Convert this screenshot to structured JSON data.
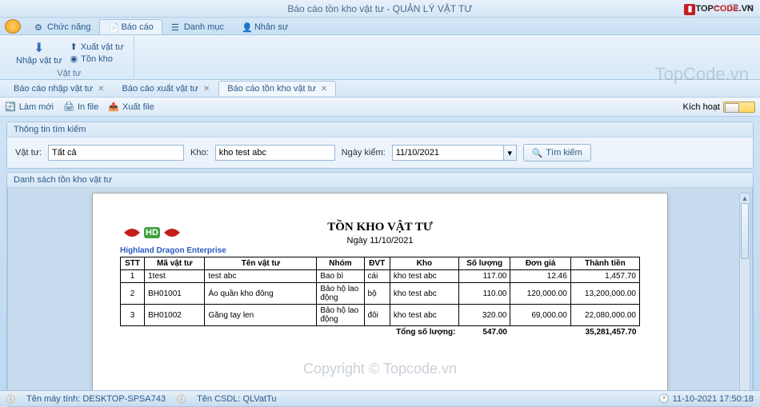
{
  "window": {
    "title": "Báo cáo tồn kho vật tư - QUẢN LÝ VẬT TƯ",
    "watermark_top_1": "TOP",
    "watermark_top_2": "CODE",
    "watermark_top_3": ".VN",
    "watermark_large": "TopCode.vn",
    "watermark_center": "Copyright © Topcode.vn"
  },
  "ribbon": {
    "tabs": {
      "chucnang": "Chức năng",
      "baocao": "Báo cáo",
      "danhmuc": "Danh mục",
      "nhansu": "Nhân sự"
    },
    "nhap": "Nhập vật tư",
    "xuat": "Xuất vật tư",
    "tonkho": "Tồn kho",
    "group": "Vật tư"
  },
  "doctabs": {
    "nhap": "Báo cáo nhập vật tư",
    "xuat": "Báo cáo xuất vật tư",
    "ton": "Báo cáo tồn kho vật tư"
  },
  "toolbar": {
    "lammoi": "Làm mới",
    "infile": "In file",
    "xuatfile": "Xuất file",
    "kichhoat": "Kích hoạt"
  },
  "search": {
    "header": "Thông tin tìm kiếm",
    "vattu_label": "Vật tư:",
    "vattu_value": "Tất cả",
    "vattu_placeholder": "",
    "kho_label": "Kho:",
    "kho_value": "kho test abc",
    "ngay_label": "Ngày kiểm:",
    "ngay_value": "11/10/2021",
    "btn": "Tìm kiếm"
  },
  "list": {
    "header": "Danh sách tồn kho vật tư"
  },
  "report": {
    "company": "Highland Dragon Enterprise",
    "title": "TỒN KHO VẬT TƯ",
    "date": "Ngày 11/10/2021",
    "cols": {
      "stt": "STT",
      "ma": "Mã vật tư",
      "ten": "Tên vật tư",
      "nhom": "Nhóm",
      "dvt": "ĐVT",
      "kho": "Kho",
      "sl": "Số lượng",
      "dg": "Đơn giá",
      "tt": "Thành tiền"
    },
    "rows": [
      {
        "stt": "1",
        "ma": "1test",
        "ten": "test abc",
        "nhom": "Bao bì",
        "dvt": "cái",
        "kho": "kho test abc",
        "sl": "117.00",
        "dg": "12.46",
        "tt": "1,457.70"
      },
      {
        "stt": "2",
        "ma": "BH01001",
        "ten": "Áo quần kho đông",
        "nhom": "Bảo hộ lao động",
        "dvt": "bộ",
        "kho": "kho test abc",
        "sl": "110.00",
        "dg": "120,000.00",
        "tt": "13,200,000.00"
      },
      {
        "stt": "3",
        "ma": "BH01002",
        "ten": "Găng tay len",
        "nhom": "Bảo hộ lao động",
        "dvt": "đôi",
        "kho": "kho test abc",
        "sl": "320.00",
        "dg": "69,000.00",
        "tt": "22,080,000.00"
      }
    ],
    "total_label": "Tổng số lượng:",
    "total_sl": "547.00",
    "total_tt": "35,281,457.70"
  },
  "status": {
    "machine_label": "Tên máy tính:",
    "machine": "DESKTOP-SPSA743",
    "db_label": "Tên CSDL:",
    "db": "QLVatTu",
    "time": "11-10-2021 17:50:18"
  }
}
